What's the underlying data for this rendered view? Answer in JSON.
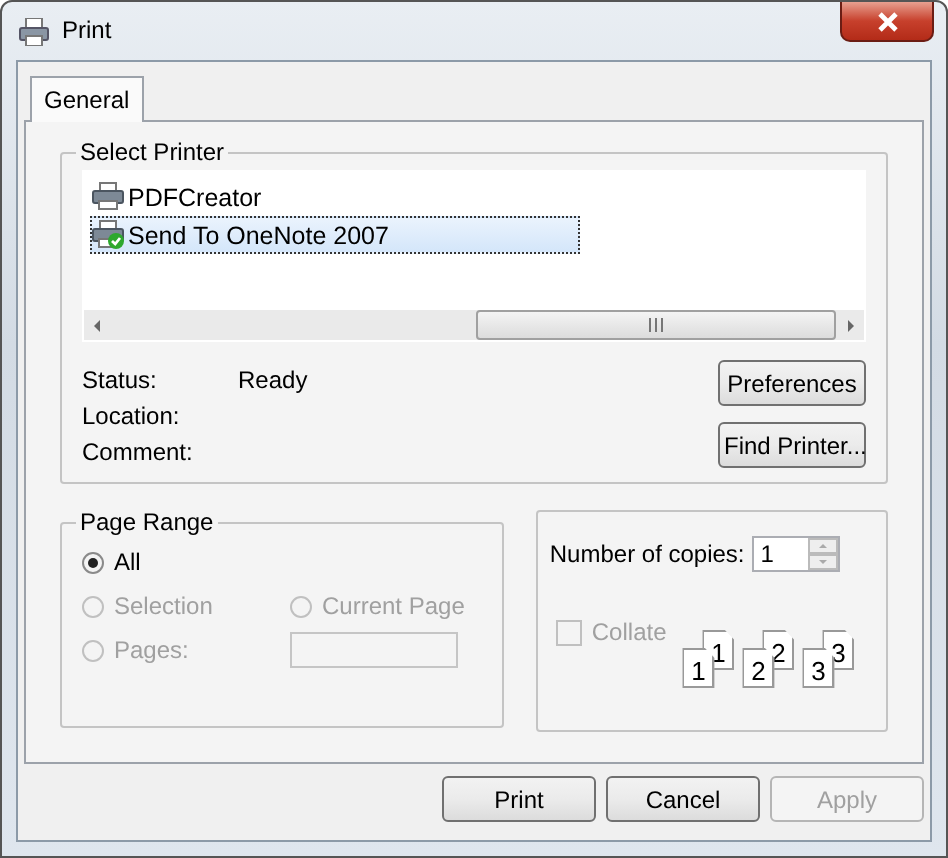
{
  "window": {
    "title": "Print"
  },
  "tabs": [
    {
      "label": "General",
      "selected": true
    }
  ],
  "select_printer": {
    "title": "Select Printer",
    "printers": [
      {
        "name": "PDFCreator",
        "selected": false,
        "default": false
      },
      {
        "name": "Send To OneNote 2007",
        "selected": true,
        "default": true
      }
    ],
    "info": [
      {
        "label": "Status:",
        "value": "Ready"
      },
      {
        "label": "Location:"
      },
      {
        "label": "Comment:"
      }
    ],
    "buttons": [
      "Preferences",
      "Find Printer..."
    ]
  },
  "page_range": {
    "title": "Page Range",
    "options": [
      {
        "label": "All",
        "selected": true,
        "disabled": false
      },
      {
        "label": "Selection",
        "selected": false,
        "disabled": true
      },
      {
        "label": "Current Page",
        "selected": false,
        "disabled": true
      },
      {
        "label": "Pages:",
        "selected": false,
        "disabled": true
      }
    ],
    "pages_field": {
      "disabled": true
    }
  },
  "copies": {
    "label": "Number of copies:",
    "value": "1"
  },
  "collate": {
    "label": "Collate",
    "checked": false,
    "disabled": true,
    "sets": [
      {
        "back": "1",
        "front": "1"
      },
      {
        "back": "2",
        "front": "2"
      },
      {
        "back": "3",
        "front": "3"
      }
    ]
  },
  "buttons": [
    {
      "label": "Print",
      "disabled": false
    },
    {
      "label": "Cancel",
      "disabled": false
    },
    {
      "label": "Apply",
      "disabled": true
    }
  ]
}
